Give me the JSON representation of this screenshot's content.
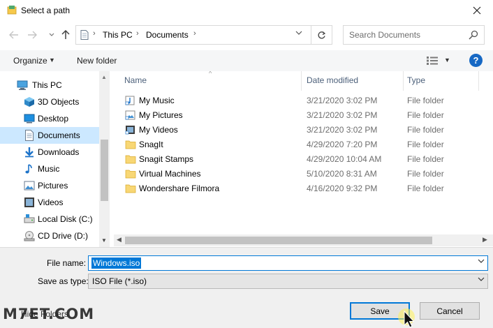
{
  "window": {
    "title": "Select a path",
    "close_icon": "close-icon"
  },
  "navigation": {
    "back_icon": "arrow-left-icon",
    "forward_icon": "arrow-right-icon",
    "recent_icon": "chevron-down-icon",
    "up_icon": "arrow-up-icon"
  },
  "address": {
    "crumbs": [
      "This PC",
      "Documents"
    ],
    "refresh_icon": "refresh-icon"
  },
  "search": {
    "placeholder": "Search Documents",
    "icon": "search-icon"
  },
  "toolbar": {
    "organize": "Organize",
    "new_folder": "New folder",
    "help": "?"
  },
  "sidebar": {
    "items": [
      {
        "label": "This PC",
        "icon": "computer-icon"
      },
      {
        "label": "3D Objects",
        "icon": "cube-icon"
      },
      {
        "label": "Desktop",
        "icon": "desktop-icon"
      },
      {
        "label": "Documents",
        "icon": "document-icon",
        "selected": true
      },
      {
        "label": "Downloads",
        "icon": "download-icon"
      },
      {
        "label": "Music",
        "icon": "music-icon"
      },
      {
        "label": "Pictures",
        "icon": "pictures-icon"
      },
      {
        "label": "Videos",
        "icon": "videos-icon"
      },
      {
        "label": "Local Disk (C:)",
        "icon": "disk-icon"
      },
      {
        "label": "CD Drive (D:)",
        "icon": "cd-drive-icon"
      }
    ]
  },
  "filelist": {
    "columns": {
      "name": "Name",
      "date": "Date modified",
      "type": "Type"
    },
    "rows": [
      {
        "name": "My Music",
        "date": "3/21/2020 3:02 PM",
        "type": "File folder",
        "icon": "music-shortcut-icon"
      },
      {
        "name": "My Pictures",
        "date": "3/21/2020 3:02 PM",
        "type": "File folder",
        "icon": "pictures-shortcut-icon"
      },
      {
        "name": "My Videos",
        "date": "3/21/2020 3:02 PM",
        "type": "File folder",
        "icon": "videos-shortcut-icon"
      },
      {
        "name": "SnagIt",
        "date": "4/29/2020 7:20 PM",
        "type": "File folder",
        "icon": "folder-icon"
      },
      {
        "name": "Snagit Stamps",
        "date": "4/29/2020 10:04 AM",
        "type": "File folder",
        "icon": "folder-icon"
      },
      {
        "name": "Virtual Machines",
        "date": "5/10/2020 8:31 AM",
        "type": "File folder",
        "icon": "folder-icon"
      },
      {
        "name": "Wondershare Filmora",
        "date": "4/16/2020 9:32 PM",
        "type": "File folder",
        "icon": "folder-icon"
      }
    ]
  },
  "save": {
    "filename_label": "File name:",
    "filename_value": "Windows.iso",
    "type_label": "Save as type:",
    "type_value": "ISO File (*.iso)",
    "hide_folders": "Hide Folders",
    "save_button": "Save",
    "cancel_button": "Cancel"
  },
  "watermark": "M7ET.COM",
  "colors": {
    "accent": "#0078d7",
    "selection": "#cce8ff",
    "folder": "#f8d775",
    "help": "#1668c4"
  }
}
